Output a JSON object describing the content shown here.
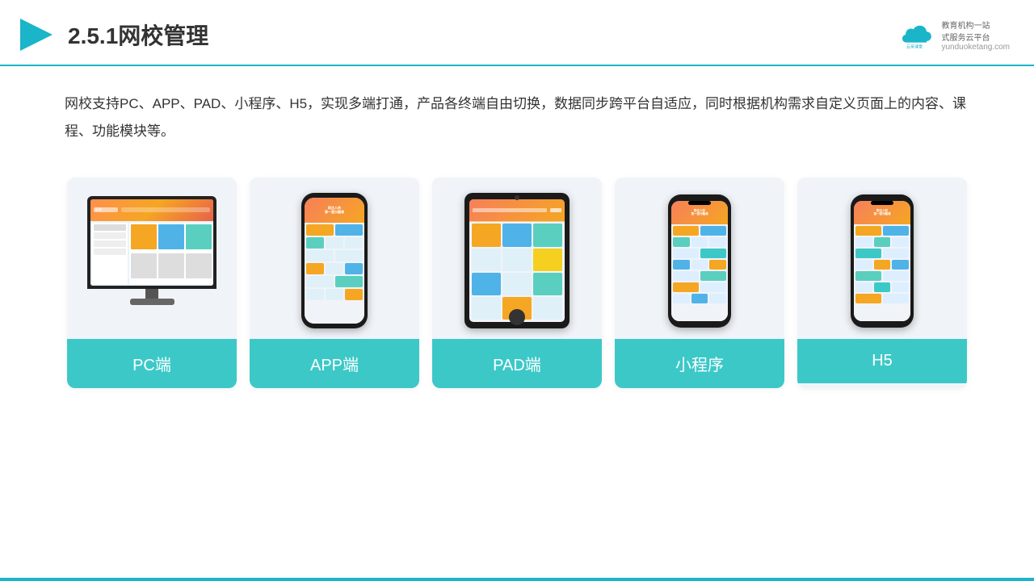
{
  "header": {
    "title": "2.5.1网校管理",
    "logo_name": "云朵课堂",
    "logo_url": "yunduoketang.com",
    "logo_tagline": "教育机构一站\n式服务云平台"
  },
  "description": {
    "text": "网校支持PC、APP、PAD、小程序、H5，实现多端打通，产品各终端自由切换，数据同步跨平台自适应，同时根据机构需求自定义页面上的内容、课程、功能模块等。"
  },
  "cards": [
    {
      "label": "PC端",
      "type": "pc"
    },
    {
      "label": "APP端",
      "type": "phone"
    },
    {
      "label": "PAD端",
      "type": "ipad"
    },
    {
      "label": "小程序",
      "type": "mini-phone"
    },
    {
      "label": "H5",
      "type": "mini-phone2"
    }
  ],
  "colors": {
    "accent": "#1ab5c8",
    "card_label_bg": "#3dc8c8",
    "title_color": "#333333",
    "text_color": "#333333"
  }
}
